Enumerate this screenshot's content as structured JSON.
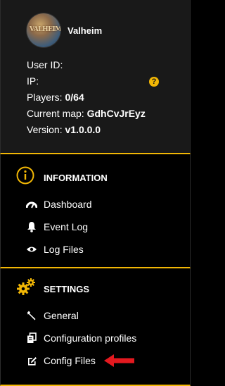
{
  "server": {
    "name": "Valheim",
    "logo_text": "VALHEIM",
    "user_id_label": "User ID:",
    "user_id_value": "",
    "ip_label": "IP:",
    "ip_value": "",
    "players_label": "Players:",
    "players_value": "0/64",
    "map_label": "Current map:",
    "map_value": "GdhCvJrEyz",
    "version_label": "Version:",
    "version_value": "v1.0.0.0",
    "help_glyph": "?"
  },
  "information": {
    "title": "INFORMATION",
    "items": [
      {
        "label": "Dashboard",
        "icon": "gauge-icon"
      },
      {
        "label": "Event Log",
        "icon": "bell-icon"
      },
      {
        "label": "Log Files",
        "icon": "eye-icon"
      }
    ]
  },
  "settings": {
    "title": "SETTINGS",
    "items": [
      {
        "label": "General",
        "icon": "wrench-icon"
      },
      {
        "label": "Configuration profiles",
        "icon": "copy-icon"
      },
      {
        "label": "Config Files",
        "icon": "edit-icon"
      }
    ]
  },
  "colors": {
    "accent": "#f2b705",
    "arrow": "#e3191f",
    "panel": "#191919"
  }
}
